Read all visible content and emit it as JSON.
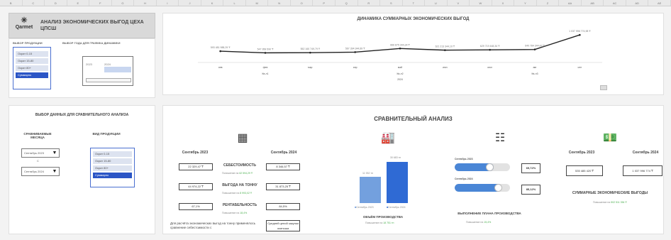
{
  "colhdr": [
    "B",
    "C",
    "D",
    "E",
    "F",
    "G",
    "H",
    "I",
    "J",
    "K",
    "L",
    "M",
    "N",
    "O",
    "P",
    "Q",
    "R",
    "S",
    "T",
    "U",
    "V",
    "W",
    "X",
    "Y",
    "Z",
    "AA",
    "AB",
    "AC",
    "AD",
    "AE"
  ],
  "app": {
    "logo_text": "Qarmet",
    "title": "АНАЛИЗ ЭКОНОМИЧЕСКИХ ВЫГОД ЦЕХА ЦПСШ"
  },
  "slicers": {
    "product_label": "ВЫБОР ПРОДУКЦИИ",
    "year_label": "ВЫБОР ГОДА ДЛЯ ГРАФИКА ДИНАМИКИ",
    "products": [
      "Ократ 0-15",
      "Ократ 15-80",
      "Ократ 80+",
      "Суммарно"
    ],
    "years": [
      "2023",
      "2024"
    ]
  },
  "chart_data": {
    "type": "line",
    "title": "ДИНАМИКА СУММАРНЫХ ЭКОНОМИЧЕСКИХ ВЫГОД",
    "categories": [
      "янв",
      "фев",
      "мар",
      "апр",
      "май",
      "июн",
      "июл",
      "авг",
      "сен"
    ],
    "x_group_labels": [
      "Кв-л1",
      "Кв-л2",
      "Кв-л3"
    ],
    "year_label": "2024",
    "series": [
      {
        "values": [
          593,
          548,
          552,
          567,
          667,
          621,
          630,
          640,
          1038
        ]
      }
    ],
    "value_labels": [
      "593 481 988,29 ₸",
      "547 958 590 ₸",
      "552 160 749,79 ₸",
      "567 394 344,89 ₸",
      "666 875 344,34 ₸",
      "621 213 344,10 ₸",
      "629 719 448,34 ₸",
      "640 784 344,42 ₸",
      "1 037 996 774,98 ₸"
    ],
    "ylim": [
      400,
      1100
    ]
  },
  "compare_left": {
    "title": "ВЫБОР ДАННЫХ ДЛЯ СРАВНИТЕЛЬНОГО АНАЛИЗА",
    "months_label": "СРАВНИВАЕМЫЕ МЕСЯЦА",
    "product_label": "ВИД ПРОДУКЦИИ",
    "month1": "Сентябрь 2023",
    "month2": "Сентябрь 2024",
    "and_text": "С"
  },
  "compare": {
    "title": "СРАВНИТЕЛЬНЫЙ АНАЛИЗ",
    "col1": "Сентябрь 2023",
    "col2": "Сентябрь 2024",
    "cost_label": "СЕБЕСТОИМОСТЬ",
    "cost1": "22 329,47 ₸",
    "cost2": "8 346,57 ₸",
    "cost_note": "Понижение на",
    "cost_change": "62 594,29 ₸",
    "profit_label": "ВЫГОДА НА ТОННУ",
    "profit1": "44 974,22 ₸",
    "profit2": "31 873,25 ₸",
    "profit_note": "Повышение на",
    "profit_change": "8 993,02 ₸",
    "rent_label": "РЕНТАБЕЛЬНОСТЬ",
    "rent1": "67,1%",
    "rent2": "84,5%",
    "rent_note": "Повышение на",
    "rent_change": "18,4%",
    "footnote": "Для расчёта экономических выгод на тонну применялось сравнение себестоимости с",
    "footbox": "Средней ценой закупки окатыша",
    "vol_bar1": "11 932 тн",
    "vol_bar2": "30 683 тн",
    "vol_legend1": "Сентябрь 2023",
    "vol_legend2": "Сентябрь 2024",
    "vol_title": "ОБЪЁМ ПРОИЗВОДСТВА",
    "vol_note": "Повышение на",
    "vol_change": "18 751 тн",
    "plan_m1": "Сентябрь 2023",
    "plan_m2": "Сентябрь 2024",
    "plan_v1": "69,72%",
    "plan_v2": "85,12%",
    "plan_title": "ВЫПОЛНЕНИЕ ПЛАНА ПРОИЗВОДСТВА",
    "plan_note": "Повышение на",
    "plan_change": "15,4%",
    "eco_col1": "Сентябрь 2023",
    "eco_col2": "Сентябрь 2024",
    "eco_v1": "535 485 420 ₸",
    "eco_v2": "1 037 996 774 ₸",
    "eco_title": "СУММАРНЫЕ ЭКОНОМИЧЕСКИЕ ВЫГОДЫ",
    "eco_note": "Повышение на",
    "eco_change": "502 511 354 ₸"
  }
}
